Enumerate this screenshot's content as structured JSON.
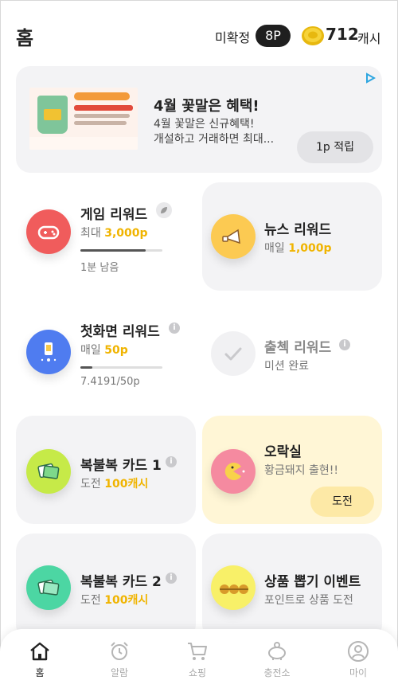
{
  "header": {
    "title": "홈",
    "pending_label": "미확정",
    "pending_value": "8P",
    "cash_amount": "712",
    "cash_unit": "캐시"
  },
  "ad": {
    "title": "4월 꽃말은 혜택!",
    "desc_line1": "4월 꽃말은 신규혜택!",
    "desc_line2": "개설하고 거래하면 최대...",
    "button": "1p 적립"
  },
  "cards": {
    "game": {
      "title": "게임 리워드",
      "sub_prefix": "최대 ",
      "sub_value": "3,000p",
      "progress_text": "1분 남음",
      "progress": 0.8
    },
    "news": {
      "title": "뉴스 리워드",
      "sub_prefix": "매일 ",
      "sub_value": "1,000p"
    },
    "lockscreen": {
      "title": "첫화면 리워드",
      "sub_prefix": "매일 ",
      "sub_value": "50p",
      "progress_text": "7.4191/50p",
      "progress": 0.15
    },
    "checkin": {
      "title": "출첵 리워드",
      "sub": "미션 완료"
    },
    "scratch1": {
      "title": "복불복 카드 1",
      "sub_prefix": "도전 ",
      "sub_value": "100캐시"
    },
    "arcade": {
      "title": "오락실",
      "sub": "황금돼지 출현!!",
      "button": "도전"
    },
    "scratch2": {
      "title": "복불복 카드 2",
      "sub_prefix": "도전 ",
      "sub_value": "100캐시"
    },
    "gacha": {
      "title": "상품 뽑기 이벤트",
      "sub": "포인트로 상품 도전"
    }
  },
  "nav": {
    "home": "홈",
    "alarm": "알람",
    "shop": "쇼핑",
    "charge": "충전소",
    "my": "마이"
  },
  "colors": {
    "accent_yellow": "#f0b400",
    "game_icon": "#f05c5c",
    "news_icon": "#fcca52",
    "lockscreen_icon": "#4f7cf0",
    "scratch_icon": "#c6ea48",
    "arcade_icon": "#f58aa0",
    "scratch2_icon": "#4cd6a3",
    "gacha_icon": "#f8f068"
  }
}
